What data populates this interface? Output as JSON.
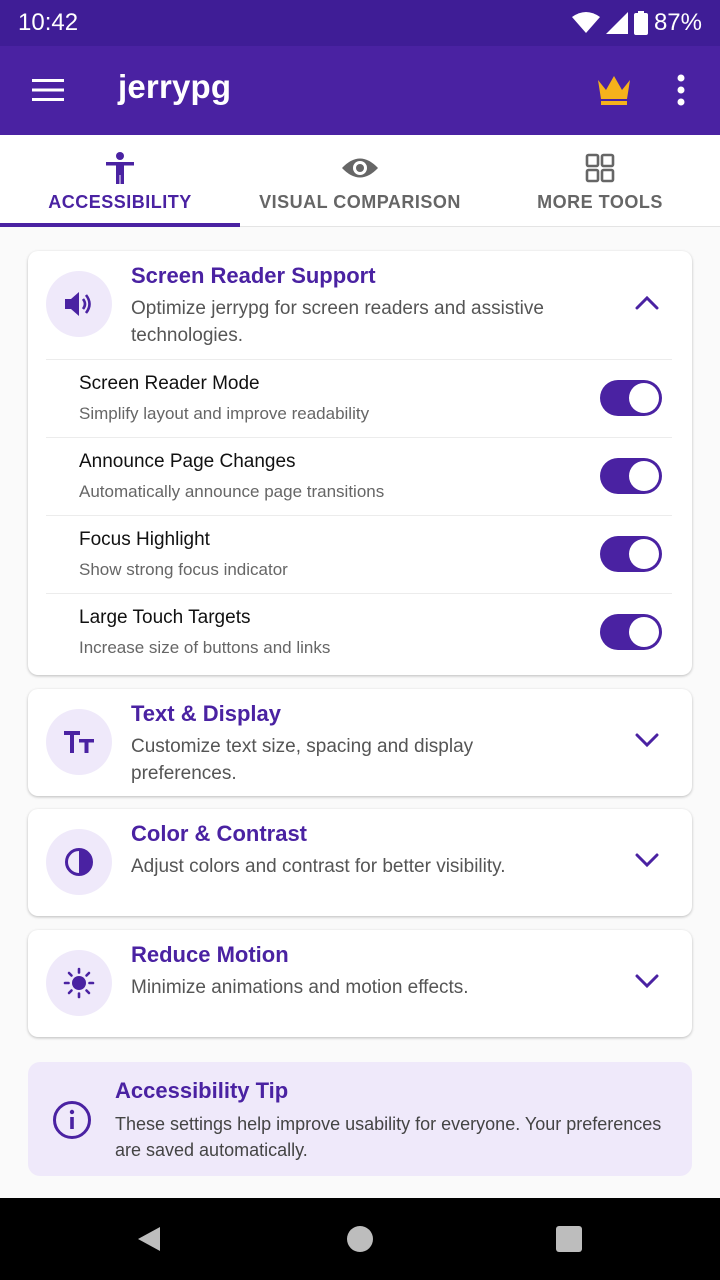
{
  "status": {
    "time": "10:42",
    "battery": "87%"
  },
  "appbar": {
    "title": "jerrypg",
    "accent": "#4a22a2",
    "crown_color": "#f6b21b"
  },
  "tabs": [
    {
      "label": "ACCESSIBILITY",
      "icon": "accessibility-icon",
      "active": true
    },
    {
      "label": "VISUAL COMPARISON",
      "icon": "eye-icon",
      "active": false
    },
    {
      "label": "MORE TOOLS",
      "icon": "grid-icon",
      "active": false
    }
  ],
  "sections": {
    "screen_reader": {
      "title": "Screen Reader Support",
      "desc": "Optimize jerrypg for screen readers and assistive technologies.",
      "icon": "speaker-icon",
      "expanded": true,
      "settings": [
        {
          "name": "Screen Reader Mode",
          "desc": "Simplify layout and improve readability",
          "on": true
        },
        {
          "name": "Announce Page Changes",
          "desc": "Automatically announce page transitions",
          "on": true
        },
        {
          "name": "Focus Highlight",
          "desc": "Show strong focus indicator",
          "on": true
        },
        {
          "name": "Large Touch Targets",
          "desc": "Increase size of buttons and links",
          "on": true
        }
      ]
    },
    "text_display": {
      "title": "Text & Display",
      "desc": "Customize text size, spacing and display preferences.",
      "icon": "text-size-icon",
      "expanded": false
    },
    "color_contrast": {
      "title": "Color & Contrast",
      "desc": "Adjust colors and contrast for better visibility.",
      "icon": "contrast-icon",
      "expanded": false
    },
    "reduce_motion": {
      "title": "Reduce Motion",
      "desc": "Minimize animations and motion effects.",
      "icon": "sun-icon",
      "expanded": false
    }
  },
  "tip": {
    "title": "Accessibility Tip",
    "text": "These settings help improve usability for everyone. Your preferences are saved automatically.",
    "icon": "info-icon"
  }
}
